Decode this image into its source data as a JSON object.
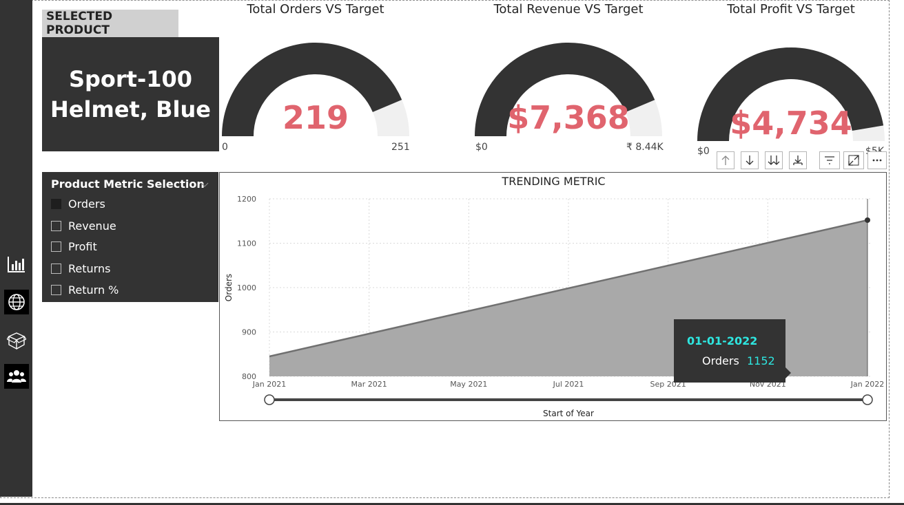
{
  "selected_product": {
    "label": "SELECTED PRODUCT",
    "name_line1": "Sport-100",
    "name_line2": "Helmet, Blue"
  },
  "gauges": [
    {
      "title": "Total Orders VS Target",
      "value_label": "219",
      "min_label": "0",
      "max_label": "251",
      "value": 219,
      "max": 251
    },
    {
      "title": "Total Revenue VS Target",
      "value_label": "$7,368",
      "min_label": "$0",
      "max_label": "₹ 8.44K",
      "value": 7368,
      "max": 8440
    },
    {
      "title": "Total Profit VS Target",
      "value_label": "$4,734",
      "min_label": "$0",
      "max_label": "$5K",
      "value": 4734,
      "max": 5000
    }
  ],
  "colors": {
    "accent_value": "#e0646e",
    "dark_panel": "#333333",
    "gauge_track": "#f0f0f0",
    "tooltip_highlight": "#2ee6e0",
    "area_fill": "#a9a9a9"
  },
  "toolbar": {
    "icons": [
      "arrow-up-icon",
      "arrow-down-icon",
      "double-arrow-down-icon",
      "expand-hierarchy-icon",
      "filter-icon",
      "focus-mode-icon",
      "more-options-icon"
    ]
  },
  "slicer": {
    "title": "Product Metric Selection",
    "items": [
      {
        "label": "Orders",
        "checked": true
      },
      {
        "label": "Revenue",
        "checked": false
      },
      {
        "label": "Profit",
        "checked": false
      },
      {
        "label": "Returns",
        "checked": false
      },
      {
        "label": "Return %",
        "checked": false
      }
    ]
  },
  "nav": {
    "icons": [
      "bar-chart-icon",
      "globe-icon",
      "box-icon",
      "people-icon"
    ]
  },
  "chart_data": {
    "type": "area",
    "title": "TRENDING METRIC",
    "xlabel": "Start of Year",
    "ylabel": "Orders",
    "x": [
      "2021-01-01",
      "2022-01-01"
    ],
    "y": [
      845,
      1152
    ],
    "x_ticks": [
      "Jan 2021",
      "Mar 2021",
      "May 2021",
      "Jul 2021",
      "Sep 2021",
      "Nov 2021",
      "Jan 2022"
    ],
    "y_ticks": [
      800,
      900,
      1000,
      1100,
      1200
    ],
    "ylim": [
      800,
      1200
    ],
    "grid": true,
    "tooltip": {
      "date": "01-01-2022",
      "label": "Orders",
      "value": "1152"
    },
    "slider": {
      "range_start": "Jan 2021",
      "range_end": "Jan 2022"
    }
  }
}
